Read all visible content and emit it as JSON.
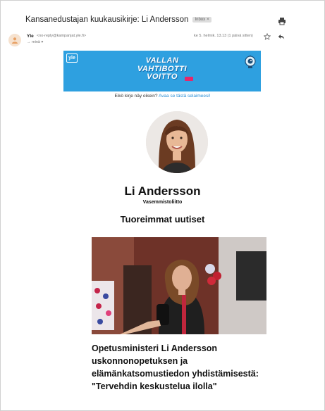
{
  "email": {
    "subject": "Kansanedustajan kuukausikirje: Li Andersson",
    "label": "Inbox",
    "label_close": "×",
    "sender_name": "Yle",
    "sender_email": "<no-reply@kampanjat.yle.fi>",
    "recipient": "→ minä ▾",
    "date": "ke 5. helmik. 13.13 (1 päivä sitten)"
  },
  "banner": {
    "logo": "yle",
    "title_line1": "VALLAN",
    "title_line2": "VAHTIBOTTI",
    "title_line3": "VOITTO"
  },
  "view_prompt": {
    "text": "Eikö kirje näy oikein?",
    "link": "Avaa se tästä selaimeesi!"
  },
  "profile": {
    "name": "Li Andersson",
    "party": "Vasemmistoliitto"
  },
  "section_heading": "Tuoreimmat uutiset",
  "news": {
    "title": "Opetusministeri Li Andersson uskonnonopetuksen ja elämänkatsomustiedon yhdistämisestä: \"Tervehdin keskustelua ilolla\""
  },
  "icons": {
    "print": "print-icon",
    "star": "star-icon",
    "reply": "reply-icon",
    "avatar": "person-icon"
  },
  "colors": {
    "banner": "#2ea0e0",
    "link": "#2a8fd6"
  }
}
